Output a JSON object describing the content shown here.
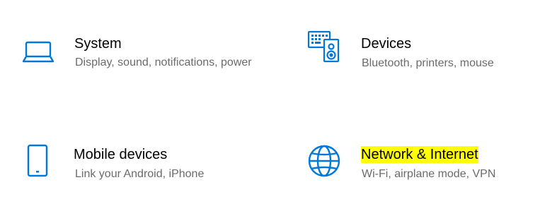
{
  "tiles": {
    "system": {
      "icon": "laptop-icon",
      "title": "System",
      "description": "Display, sound, notifications, power"
    },
    "devices": {
      "icon": "keyboard-speaker-icon",
      "title": "Devices",
      "description": "Bluetooth, printers, mouse"
    },
    "mobile": {
      "icon": "phone-icon",
      "title": "Mobile devices",
      "description": "Link your Android, iPhone"
    },
    "network": {
      "icon": "globe-icon",
      "title": "Network & Internet",
      "description": "Wi-Fi, airplane mode, VPN"
    }
  },
  "colors": {
    "icon_accent": "#0078d7",
    "title_text": "#000000",
    "description_text": "#6b6b6b",
    "highlight": "#ffff00"
  }
}
